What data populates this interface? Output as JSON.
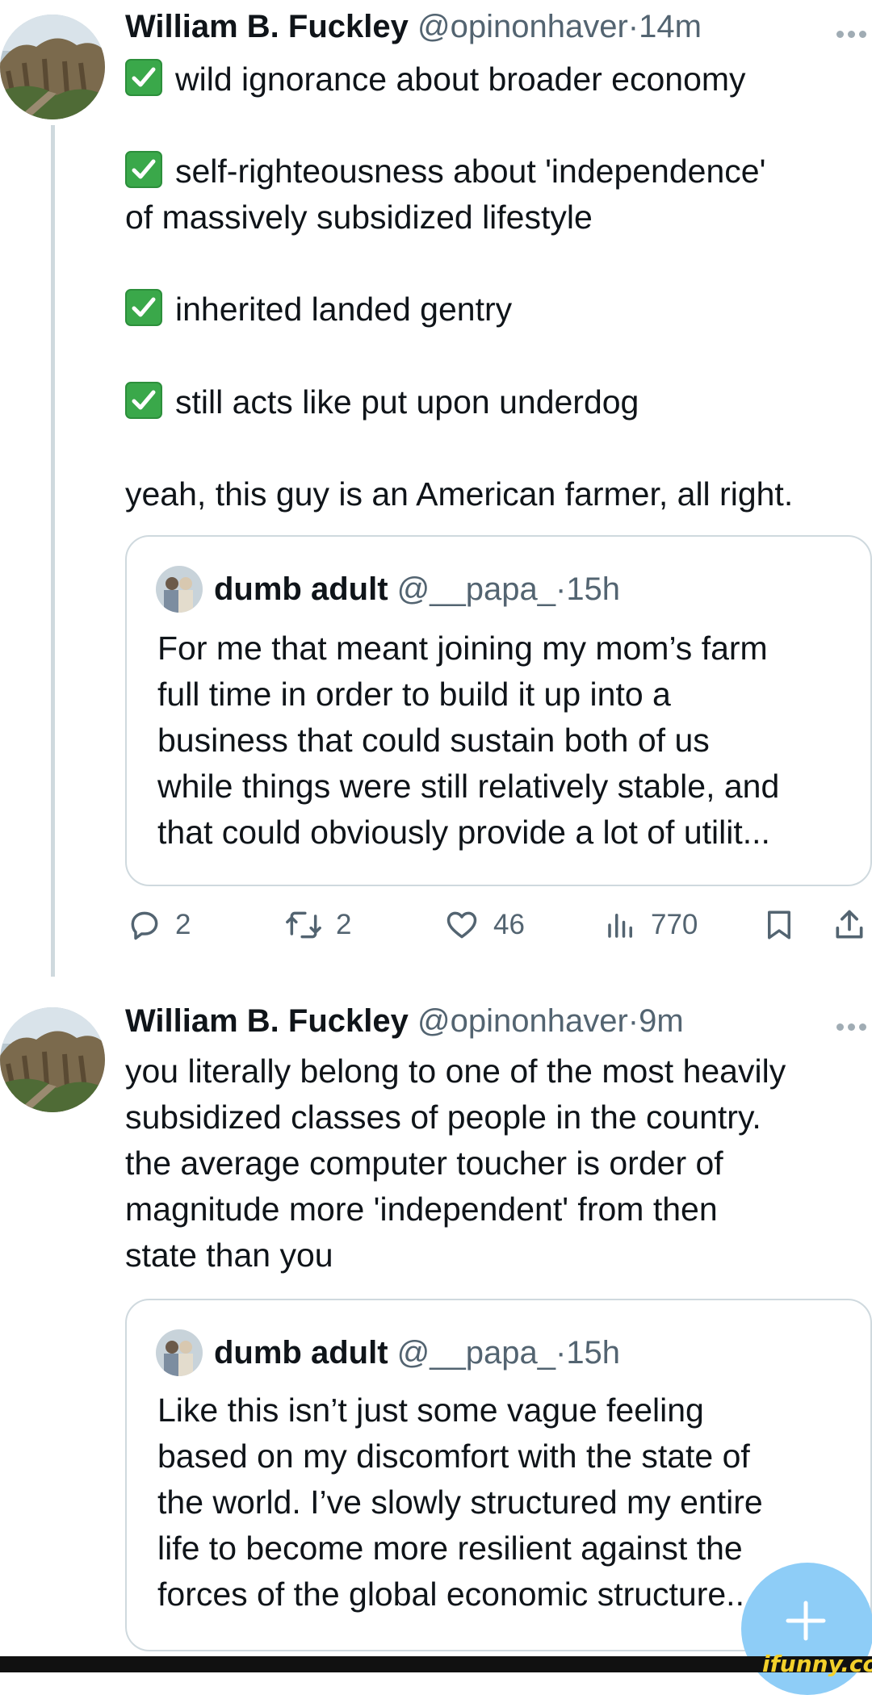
{
  "tweet1": {
    "author_name": "William B. Fuckley",
    "handle": "@opinonhaver",
    "sep": "·",
    "time": "14m",
    "lines": [
      {
        "check": true,
        "text": "wild ignorance about broader economy"
      },
      {
        "check": true,
        "text": "self-righteousness about 'independence'"
      },
      {
        "check": false,
        "text": "of massively subsidized lifestyle"
      },
      {
        "check": true,
        "text": "inherited landed gentry"
      },
      {
        "check": true,
        "text": "still acts like put upon underdog"
      },
      {
        "check": false,
        "text": "yeah, this guy is an American farmer, all right."
      }
    ],
    "quote": {
      "author_name": "dumb adult",
      "handle": "@__papa_",
      "sep": "·",
      "time": "15h",
      "lines": [
        "For me that meant joining my mom’s farm",
        "full time in order to build it up into a",
        "business that could sustain both of us",
        "while things were still relatively stable, and",
        "that could obviously provide a lot of utilit..."
      ]
    },
    "actions": {
      "replies": "2",
      "reposts": "2",
      "likes": "46",
      "views": "770"
    }
  },
  "tweet2": {
    "author_name": "William B. Fuckley",
    "handle": "@opinonhaver",
    "sep": "·",
    "time": "9m",
    "lines": [
      "you literally belong to one of the most heavily",
      "subsidized classes of people in the country.",
      "the average computer toucher is order of",
      "magnitude more 'independent' from then",
      "state than you"
    ],
    "quote": {
      "author_name": "dumb adult",
      "handle": "@__papa_",
      "sep": "·",
      "time": "15h",
      "lines": [
        "Like this isn’t just some vague feeling",
        "based on my discomfort with the state of",
        "the world. I’ve slowly structured my entire",
        "life to become more resilient against the",
        "forces of the global economic structure...."
      ]
    }
  },
  "watermark": "ifunny.co",
  "icons": {
    "reply": "reply-icon",
    "repost": "repost-icon",
    "like": "heart-icon",
    "views": "views-icon",
    "bookmark": "bookmark-icon",
    "share": "share-icon",
    "more": "more-icon",
    "compose": "compose-plus-icon"
  },
  "colors": {
    "text": "#0f1419",
    "muted": "#536471",
    "border": "#cfd9de",
    "check_green": "#3aa84a",
    "fab_blue": "#8ecdf7"
  }
}
